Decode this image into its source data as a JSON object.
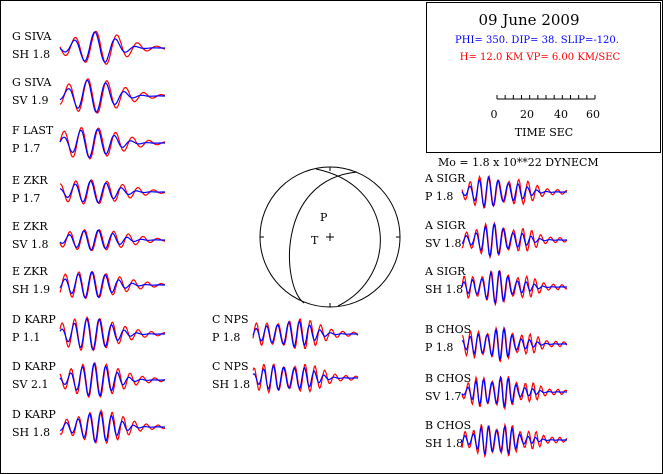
{
  "colors": {
    "observed": "#0000ff",
    "synthetic": "#ff0000",
    "frame": "#000000",
    "params_blue": "#0000ff",
    "params_red": "#ff0000"
  },
  "header": {
    "date": "09 June 2009",
    "mechanism": "PHI= 350. DIP= 38. SLIP=-120.",
    "depth_vp": "H= 12.0 KM  VP= 6.00 KM/SEC",
    "scale_ticks": [
      "0",
      "20",
      "40",
      "60"
    ],
    "scale_label": "TIME   SEC",
    "moment": "Mo =  1.8 x 10**22 DYNECM"
  },
  "traces": [
    {
      "id": "g-siva-sh",
      "station": "G  SIVA",
      "comp": "SH",
      "amp": "1.8"
    },
    {
      "id": "g-siva-sv",
      "station": "G  SIVA",
      "comp": "SV",
      "amp": "1.9"
    },
    {
      "id": "f-last-p",
      "station": "F  LAST",
      "comp": "P",
      "amp": "1.7"
    },
    {
      "id": "e-zkr-p",
      "station": "E  ZKR",
      "comp": "P",
      "amp": "1.7"
    },
    {
      "id": "e-zkr-sv",
      "station": "E  ZKR",
      "comp": "SV",
      "amp": "1.8"
    },
    {
      "id": "e-zkr-sh",
      "station": "E  ZKR",
      "comp": "SH",
      "amp": "1.9"
    },
    {
      "id": "d-karp-p",
      "station": "D  KARP",
      "comp": "P",
      "amp": "1.1"
    },
    {
      "id": "d-karp-sv",
      "station": "D  KARP",
      "comp": "SV",
      "amp": "2.1"
    },
    {
      "id": "d-karp-sh",
      "station": "D  KARP",
      "comp": "SH",
      "amp": "1.8"
    },
    {
      "id": "c-nps-p",
      "station": "C  NPS",
      "comp": "P",
      "amp": "1.8"
    },
    {
      "id": "c-nps-sh",
      "station": "C  NPS",
      "comp": "SH",
      "amp": "1.8"
    },
    {
      "id": "a-sigr-p",
      "station": "A  SIGR",
      "comp": "P",
      "amp": "1.8"
    },
    {
      "id": "a-sigr-sv",
      "station": "A  SIGR",
      "comp": "SV",
      "amp": "1.8"
    },
    {
      "id": "a-sigr-sh",
      "station": "A  SIGR",
      "comp": "SH",
      "amp": "1.8"
    },
    {
      "id": "b-chos-p",
      "station": "B  CHOS",
      "comp": "P",
      "amp": "1.8"
    },
    {
      "id": "b-chos-sv",
      "station": "B  CHOS",
      "comp": "SV",
      "amp": "1.7"
    },
    {
      "id": "b-chos-sh",
      "station": "B  CHOS",
      "comp": "SH",
      "amp": "1.8"
    }
  ]
}
